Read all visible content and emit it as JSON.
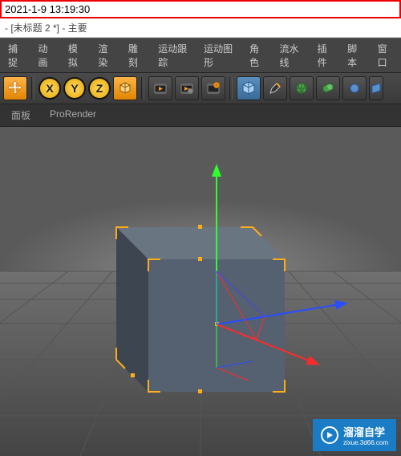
{
  "timestamp": "2021-1-9 13:19:30",
  "window": {
    "title": " - [未标题 2 *] - 主要"
  },
  "menu": {
    "items": [
      "捕捉",
      "动画",
      "模拟",
      "渲染",
      "雕刻",
      "运动跟踪",
      "运动图形",
      "角色",
      "流水线",
      "插件",
      "脚本",
      "窗口"
    ]
  },
  "axis": {
    "x": "X",
    "y": "Y",
    "z": "Z"
  },
  "tabs": {
    "panel": "面板",
    "prorender": "ProRender"
  },
  "icons": {
    "move": "move-icon",
    "cube": "cube-primitive-icon",
    "film1": "film-icon",
    "film2": "film-settings-icon",
    "film3": "film-options-icon",
    "lightcube": "cube-light-icon",
    "pen": "pen-icon",
    "qball": "quad-sphere-icon",
    "stack": "array-icon",
    "blob": "boolean-icon",
    "plane": "plane-icon"
  },
  "watermark": {
    "brand": "溜溜自学",
    "url": "zixue.3d66.com"
  },
  "colors": {
    "accent_orange": "#ff9a1f",
    "axis_x": "#ff2a2a",
    "axis_y": "#2dff2d",
    "axis_z": "#2a4dff",
    "select": "#ffae1a"
  }
}
